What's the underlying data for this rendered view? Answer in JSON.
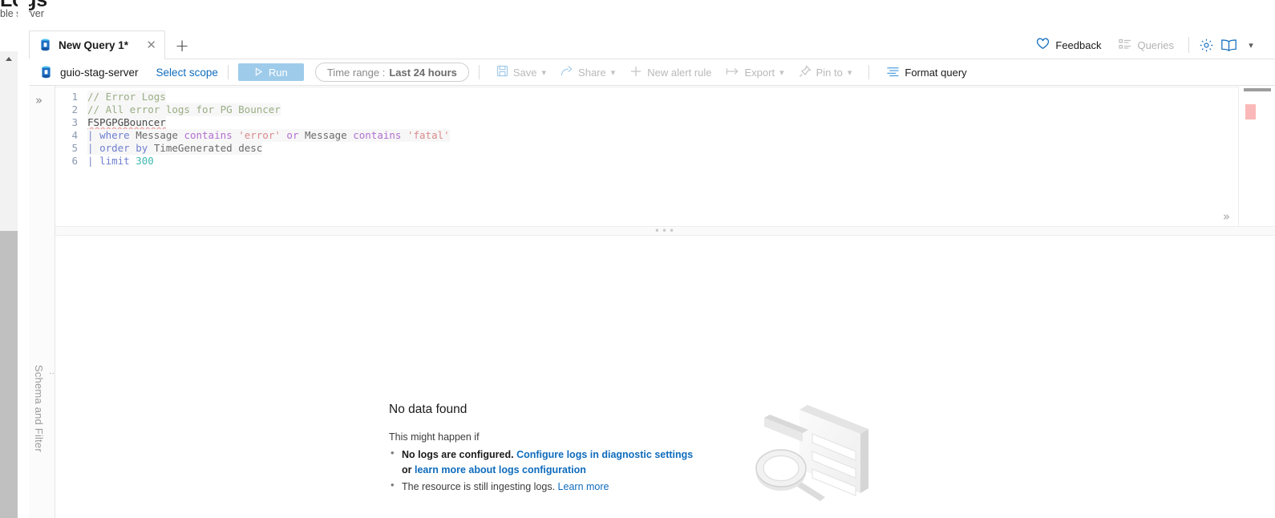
{
  "page": {
    "title": "Logs",
    "subtitle": "ble server"
  },
  "tabs": {
    "items": [
      {
        "label": "New Query 1*",
        "icon": "database-icon",
        "close_icon": "close-icon"
      }
    ],
    "add_label": "+",
    "add_icon": "plus-icon"
  },
  "header_right": {
    "feedback_label": "Feedback",
    "feedback_icon": "heart-icon",
    "queries_label": "Queries",
    "queries_icon": "queries-list-icon",
    "settings_icon": "gear-icon",
    "help_icon": "book-icon",
    "help_chevron": "chevron-down-icon"
  },
  "command_bar": {
    "scope_name": "guio-stag-server",
    "scope_icon": "database-icon",
    "select_scope_label": "Select scope",
    "run_label": "Run",
    "run_icon": "play-icon",
    "time_range_label": "Time range :",
    "time_range_value": "Last 24 hours",
    "save_label": "Save",
    "save_icon": "save-disk-icon",
    "save_chevron": "chevron-down-icon",
    "share_label": "Share",
    "share_icon": "share-icon",
    "share_chevron": "chevron-down-icon",
    "new_alert_label": "New alert rule",
    "new_alert_icon": "plus-icon",
    "export_label": "Export",
    "export_icon": "export-arrow-icon",
    "export_chevron": "chevron-down-icon",
    "pin_label": "Pin to",
    "pin_icon": "pin-icon",
    "pin_chevron": "chevron-down-icon",
    "format_label": "Format query",
    "format_icon": "format-lines-icon"
  },
  "left_rail": {
    "expand_icon": "double-chevron-right-icon",
    "label": "Schema and Filter",
    "grip_icon": "grip-dots-icon"
  },
  "editor": {
    "line_numbers": [
      "1",
      "2",
      "3",
      "4",
      "5",
      "6"
    ],
    "lines": [
      "// Error Logs",
      "// All error logs for PG Bouncer",
      "FSPGPGBouncer",
      "| where Message contains 'error' or Message contains 'fatal'",
      "| order by TimeGenerated desc",
      "| limit 300"
    ],
    "tokens": {
      "l1_comment": "// Error Logs",
      "l2_comment": "// All error logs for PG Bouncer",
      "l3_table": "FSPGPGBouncer",
      "l4_pipe": "|",
      "l4_where": "where",
      "l4_msg1": "Message",
      "l4_contains1": "contains",
      "l4_str1": "'error'",
      "l4_or": "or",
      "l4_msg2": "Message",
      "l4_contains2": "contains",
      "l4_str2": "'fatal'",
      "l5_pipe": "|",
      "l5_order": "order by",
      "l5_field": "TimeGenerated",
      "l5_desc": "desc",
      "l6_pipe": "|",
      "l6_limit": "limit",
      "l6_num": "300"
    },
    "error_marker": "error-marker",
    "collapse_icon": "double-chevron-up-icon",
    "splitter_icon": "splitter-dots-icon"
  },
  "results": {
    "title": "No data found",
    "subtitle": "This might happen if",
    "bullets": [
      {
        "bold": "No logs are configured.",
        "link1": "Configure logs in diagnostic settings",
        "mid": "or",
        "link2": "learn more about logs configuration"
      },
      {
        "text": "The resource is still ingesting logs.",
        "link": "Learn more"
      }
    ],
    "illustration": "no-data-magnifier-illustration"
  },
  "colors": {
    "accent": "#0f6cbd",
    "run_button": "#9ecbea",
    "error_marker": "#fbb8b8",
    "comment": "#9aad84",
    "keyword": "#6f7fd0",
    "string": "#d98b8b",
    "number": "#3fb9b0"
  }
}
